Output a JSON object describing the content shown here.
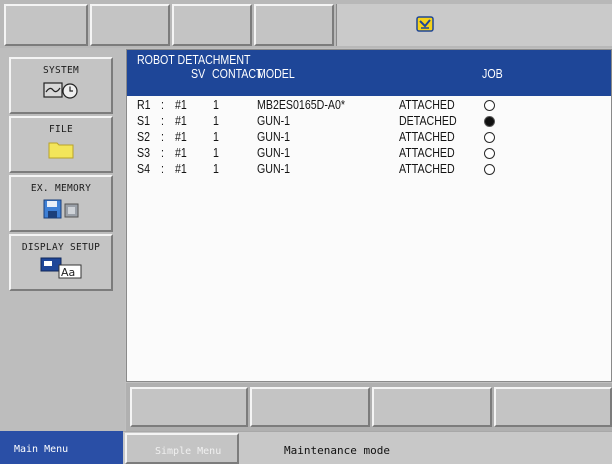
{
  "toolbar": {
    "buttons": [
      "",
      "",
      "",
      ""
    ],
    "status_icon": "robot-group-icon",
    "colors": {
      "icon_yellow": "#f5d21a",
      "icon_blue": "#1e4698"
    }
  },
  "sidebar": {
    "items": [
      {
        "label": "SYSTEM",
        "icon": "system-monitor-clock-icon"
      },
      {
        "label": "FILE",
        "icon": "folder-icon"
      },
      {
        "label": "EX. MEMORY",
        "icon": "floppy-memory-icon"
      },
      {
        "label": "DISPLAY SETUP",
        "icon": "display-font-icon"
      }
    ]
  },
  "screen": {
    "title": "ROBOT DETACHMENT",
    "headers": {
      "sv": "SV",
      "contact": "CONTACT",
      "model": "MODEL",
      "job": "JOB"
    },
    "rows": [
      {
        "robot": "R1",
        "sep": ":",
        "sv": "#1",
        "contact": "1",
        "model": "MB2ES0165D-A0*",
        "status": "ATTACHED",
        "job_selected": false
      },
      {
        "robot": "S1",
        "sep": ":",
        "sv": "#1",
        "contact": "1",
        "model": "GUN-1",
        "status": "DETACHED",
        "job_selected": true
      },
      {
        "robot": "S2",
        "sep": ":",
        "sv": "#1",
        "contact": "1",
        "model": "GUN-1",
        "status": "ATTACHED",
        "job_selected": false
      },
      {
        "robot": "S3",
        "sep": ":",
        "sv": "#1",
        "contact": "1",
        "model": "GUN-1",
        "status": "ATTACHED",
        "job_selected": false
      },
      {
        "robot": "S4",
        "sep": ":",
        "sv": "#1",
        "contact": "1",
        "model": "GUN-1",
        "status": "ATTACHED",
        "job_selected": false
      }
    ],
    "colors": {
      "header_bg": "#1e4698",
      "body_bg": "#fbfbfb"
    }
  },
  "function_keys": [
    "",
    "",
    "",
    ""
  ],
  "statusbar": {
    "main_menu": "Main Menu",
    "simple_menu": "Simple Menu",
    "mode_text": "Maintenance mode",
    "colors": {
      "main_menu_bg": "#2a4fa6"
    }
  }
}
